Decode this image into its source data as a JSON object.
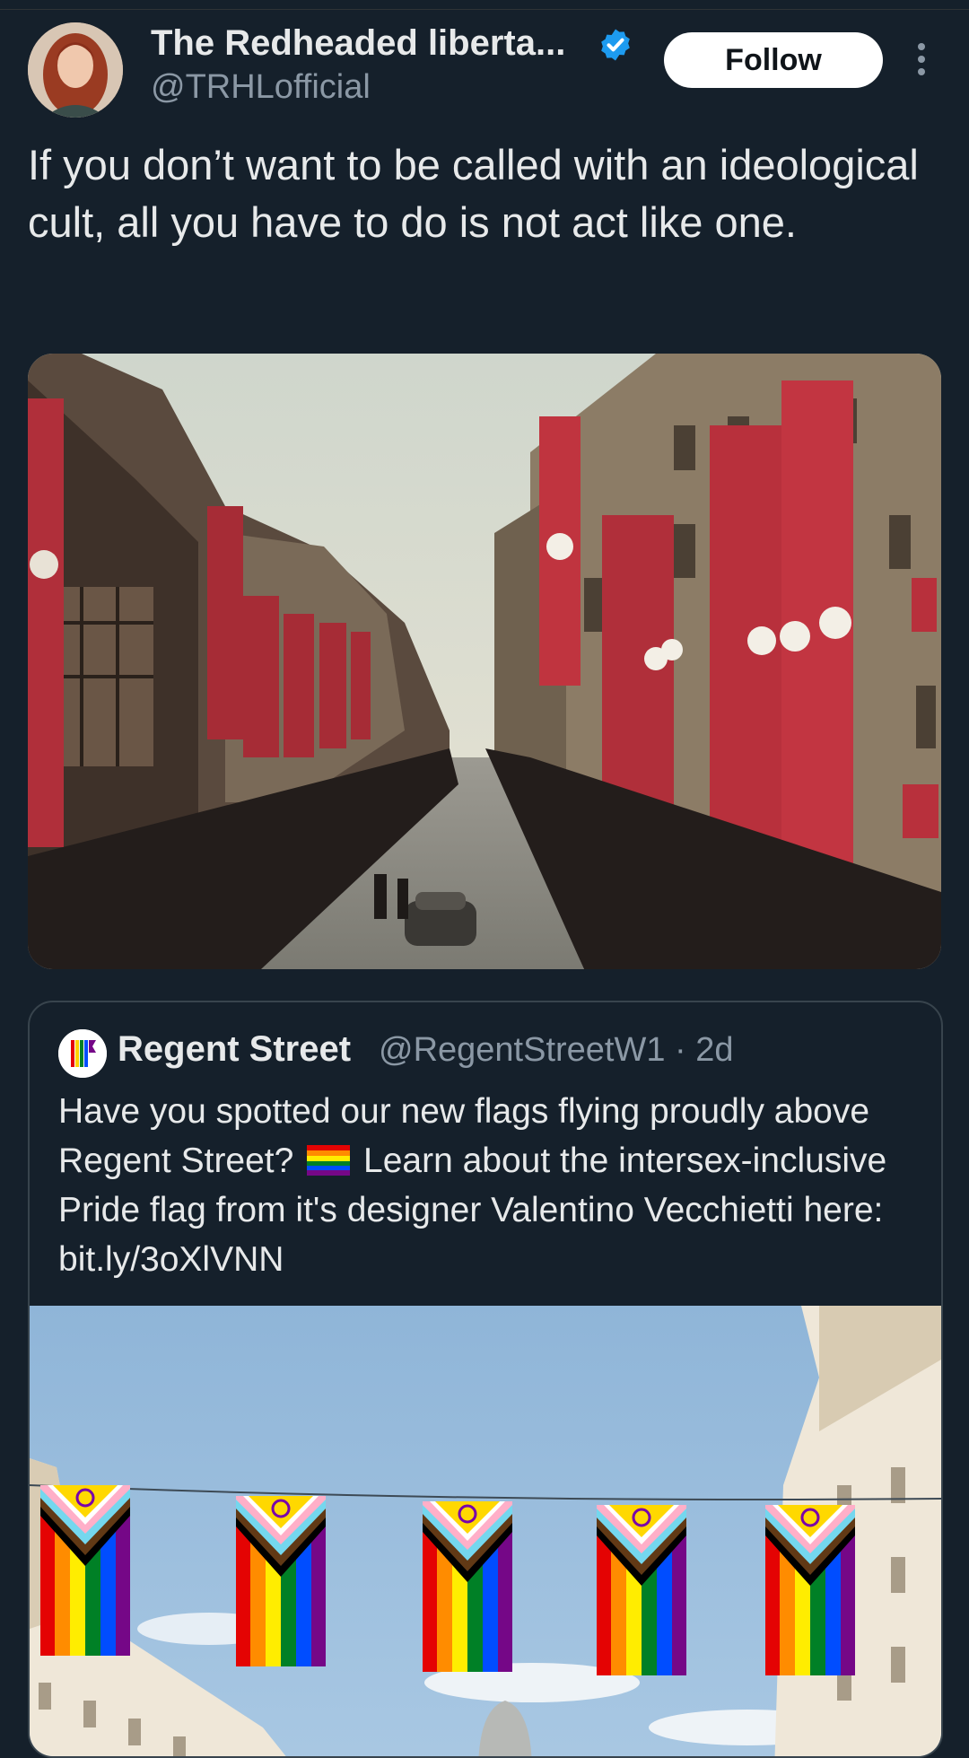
{
  "author": {
    "display_name": "The Redheaded liberta...",
    "handle": "@TRHLofficial",
    "verified_icon": "verified-badge-icon"
  },
  "follow_label": "Follow",
  "tweet_text": "If you don’t want to be called with an ideological cult, all you have to do is not act like one.",
  "quote": {
    "display_name": "Regent Street",
    "handle_time": "@RegentStreetW1 · 2d",
    "text_before_emoji": "Have you spotted our new flags flying proudly above Regent Street?",
    "emoji": "pride-flag-emoji",
    "text_after_emoji": "Learn about the intersex-inclusive Pride flag from it's designer Valentino Vecchietti here: bit.ly/3oXlVNN"
  },
  "colors": {
    "background": "#15202b",
    "text_primary": "#e7e9ea",
    "text_secondary": "#8b98a5",
    "verified": "#1d9bf0",
    "border": "#38444d"
  }
}
